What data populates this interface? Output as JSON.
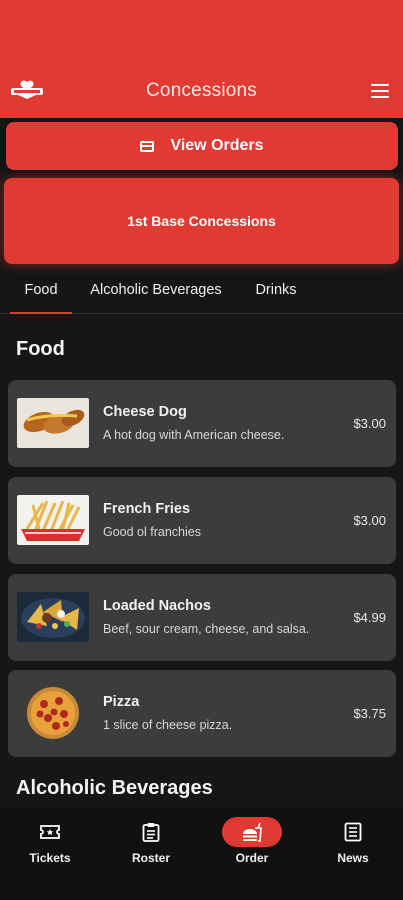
{
  "header": {
    "title": "Concessions",
    "logo_icon": "team-logo-icon",
    "menu_icon": "hamburger-menu-icon",
    "background": "#e03a33"
  },
  "actions": {
    "view_orders_label": "View Orders",
    "view_orders_icon": "credit-card-icon",
    "stand_name": "1st Base Concessions"
  },
  "tabs": [
    {
      "label": "Food",
      "active": true
    },
    {
      "label": "Alcoholic Beverages",
      "active": false
    },
    {
      "label": "Drinks",
      "active": false
    }
  ],
  "sections": [
    {
      "title": "Food",
      "items": [
        {
          "name": "Cheese Dog",
          "description": "A hot dog with American cheese.",
          "price": "$3.00",
          "image": "cheese-dog-image"
        },
        {
          "name": "French Fries",
          "description": "Good ol franchies",
          "price": "$3.00",
          "image": "french-fries-image"
        },
        {
          "name": "Loaded Nachos",
          "description": "Beef, sour cream, cheese, and salsa.",
          "price": "$4.99",
          "image": "loaded-nachos-image"
        },
        {
          "name": "Pizza",
          "description": "1 slice of cheese pizza.",
          "price": "$3.75",
          "image": "pizza-image"
        }
      ]
    },
    {
      "title": "Alcoholic Beverages",
      "items": []
    }
  ],
  "bottom_nav": [
    {
      "label": "Tickets",
      "icon": "ticket-icon",
      "active": false
    },
    {
      "label": "Roster",
      "icon": "clipboard-icon",
      "active": false
    },
    {
      "label": "Order",
      "icon": "fastfood-icon",
      "active": true
    },
    {
      "label": "News",
      "icon": "newspaper-icon",
      "active": false
    }
  ],
  "colors": {
    "accent": "#e03a33",
    "background": "#161616",
    "card": "#3c3c3c",
    "nav": "#111111"
  }
}
